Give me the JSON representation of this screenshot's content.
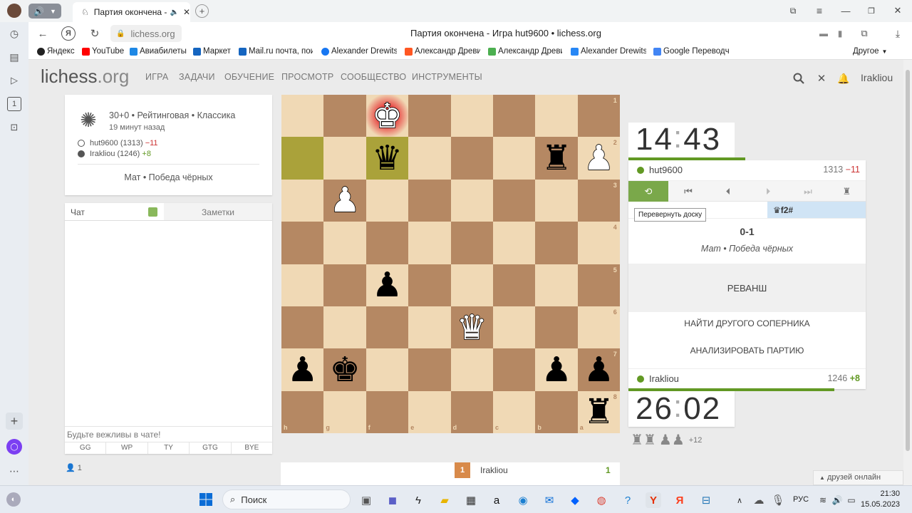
{
  "browser": {
    "tab_title": "Партия окончена - И",
    "url": "lichess.org",
    "page_title": "Партия окончена - Игра hut9600 • lichess.org",
    "bookmarks": [
      {
        "label": "Яндекс",
        "color": "#222"
      },
      {
        "label": "YouTube",
        "color": "#ff0000"
      },
      {
        "label": "Авиабилеты",
        "color": "#1e88e5"
      },
      {
        "label": "Маркет",
        "color": "#1565c0"
      },
      {
        "label": "Mail.ru почта, пои",
        "color": "#1565c0"
      },
      {
        "label": "Alexander Drewitsl",
        "color": "#1877f2"
      },
      {
        "label": "Александр Древи",
        "color": "#ff5722"
      },
      {
        "label": "Александр Древи",
        "color": "#4caf50"
      },
      {
        "label": "Alexander Drewitsl",
        "color": "#2787f5"
      },
      {
        "label": "Google Переводч",
        "color": "#4285f4"
      }
    ],
    "bookmarks_other": "Другое"
  },
  "site": {
    "logo": "lichess",
    "logo_tld": ".org",
    "nav": [
      "ИГРА",
      "ЗАДАЧИ",
      "ОБУЧЕНИЕ",
      "ПРОСМОТР",
      "СООБЩЕСТВО",
      "ИНСТРУМЕНТЫ"
    ],
    "username": "Irakliou"
  },
  "game_info": {
    "setup": "30+0 • Рейтинговая • Классика",
    "time_ago": "19 минут назад",
    "white_player": "hut9600 (1313)",
    "white_diff": "−11",
    "black_player": "Irakliou (1246)",
    "black_diff": "+8",
    "result": "Мат • Победа чёрных"
  },
  "chat": {
    "tab_chat": "Чат",
    "tab_notes": "Заметки",
    "placeholder": "Будьте вежливы в чате!",
    "presets": [
      "GG",
      "WP",
      "TY",
      "GTG",
      "BYE"
    ],
    "watchers": "1"
  },
  "board": {
    "files": [
      "h",
      "g",
      "f",
      "e",
      "d",
      "c",
      "b",
      "a"
    ],
    "ranks": [
      "1",
      "2",
      "3",
      "4",
      "5",
      "6",
      "7",
      "8"
    ]
  },
  "right": {
    "top_clock_min": "14",
    "top_clock_sec": "43",
    "top_player": "hut9600",
    "top_rating": "1313",
    "top_diff": "−11",
    "flip_tooltip": "Перевернуть доску",
    "last_move": "♛f2#",
    "score": "0-1",
    "result_text": "Мат • Победа чёрных",
    "rematch": "РЕВАНШ",
    "new_opponent": "НАЙТИ ДРУГОГО СОПЕРНИКА",
    "analyze": "АНАЛИЗИРОВАТЬ ПАРТИЮ",
    "bottom_player": "Irakliou",
    "bottom_rating": "1246",
    "bottom_diff": "+8",
    "bottom_clock_min": "26",
    "bottom_clock_sec": "02",
    "material": "+12"
  },
  "crosstable": {
    "rank": "1",
    "player": "Irakliou",
    "score": "1"
  },
  "friends": "друзей онлайн",
  "taskbar": {
    "search": "Поиск",
    "lang": "РУС",
    "time": "21:30",
    "date": "15.05.2023"
  }
}
